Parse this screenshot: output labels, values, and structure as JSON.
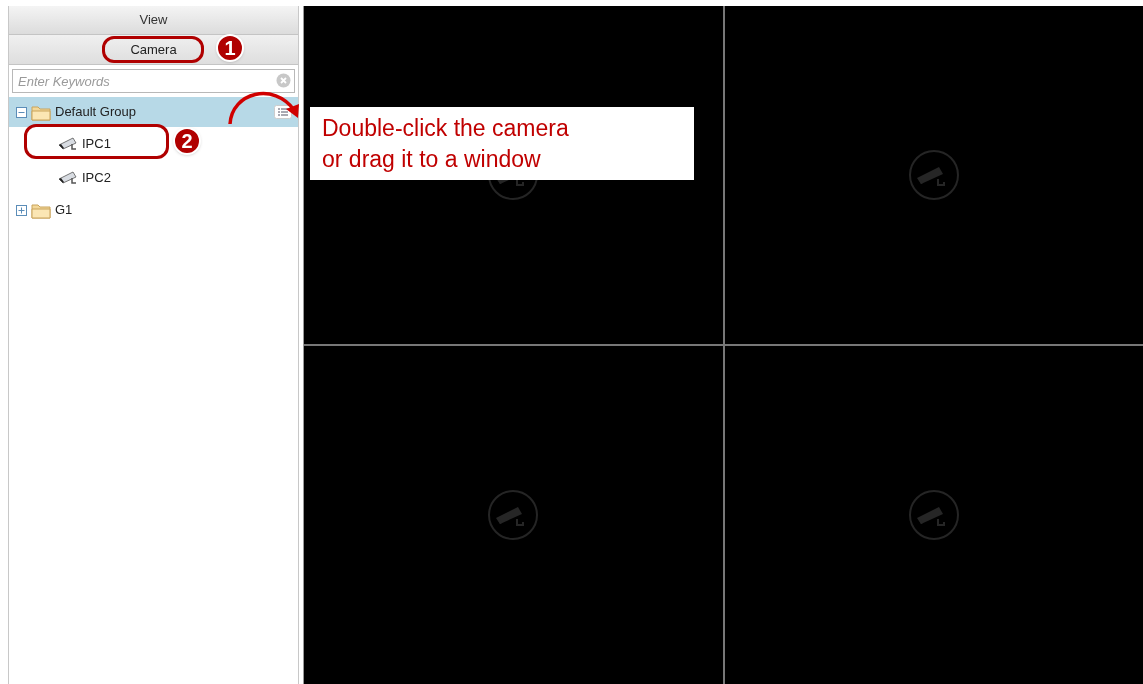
{
  "panel": {
    "header": "View",
    "tabs": [
      {
        "label": "Camera",
        "selected": true
      }
    ],
    "search": {
      "placeholder": "Enter Keywords"
    },
    "tree": [
      {
        "label": "Default Group",
        "expanded": true,
        "selected": true,
        "children": [
          {
            "label": "IPC1",
            "selected": false
          },
          {
            "label": "IPC2",
            "selected": false
          }
        ]
      },
      {
        "label": "G1",
        "expanded": false,
        "selected": false
      }
    ]
  },
  "video_grid": {
    "windows": [
      {
        "kind": "empty"
      },
      {
        "kind": "empty"
      },
      {
        "kind": "empty"
      },
      {
        "kind": "empty"
      }
    ]
  },
  "annotations": {
    "steps": [
      {
        "number": "1"
      },
      {
        "number": "2"
      }
    ],
    "callout": [
      "Double-click the camera",
      "or drag it to a window"
    ]
  }
}
